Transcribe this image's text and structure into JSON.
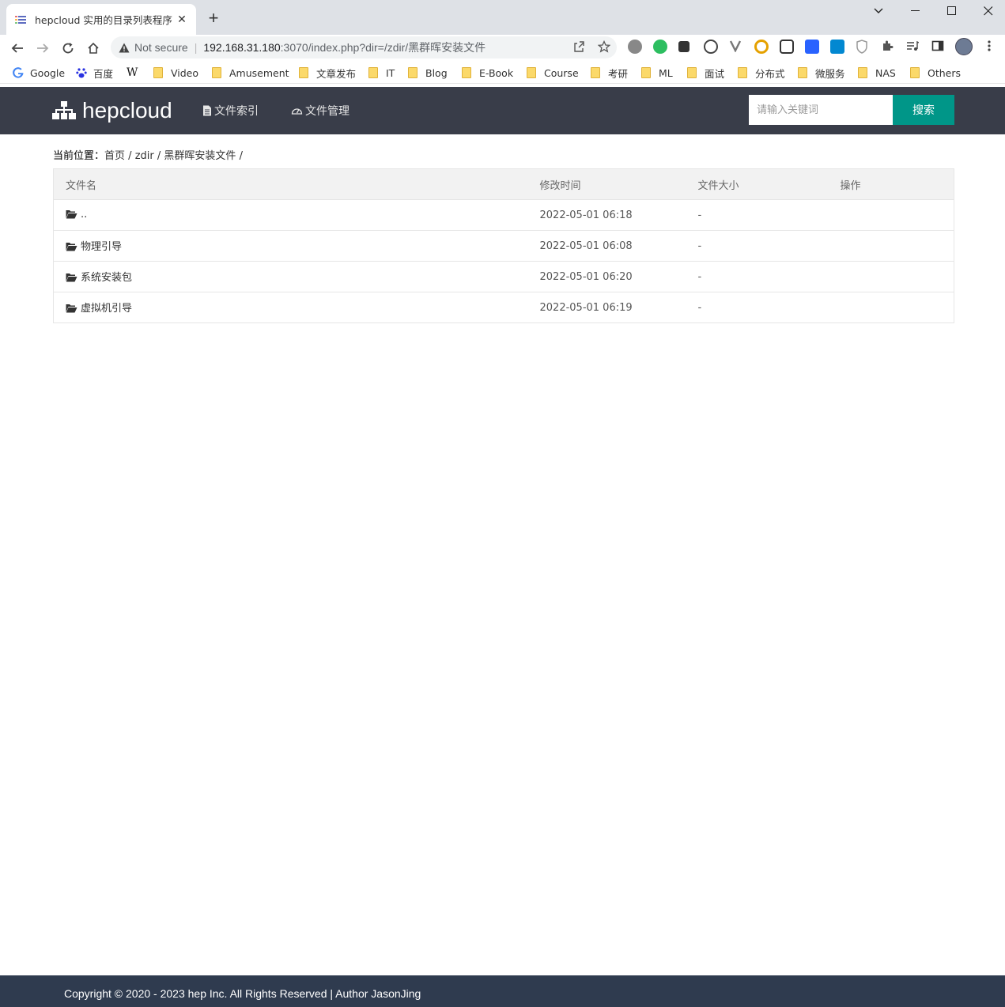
{
  "browser": {
    "tab_title": "hepcloud 实用的目录列表程序",
    "omnibox": {
      "security_label": "Not secure",
      "host": "192.168.31.180",
      "path": ":3070/index.php?dir=/zdir/黑群晖安装文件"
    },
    "bookmarks": [
      "Google",
      "百度",
      "Video",
      "Amusement",
      "文章发布",
      "IT",
      "Blog",
      "E-Book",
      "Course",
      "考研",
      "ML",
      "面试",
      "分布式",
      "微服务",
      "NAS",
      "Others"
    ]
  },
  "site": {
    "logo_text": "hepcloud",
    "nav": [
      {
        "label": "文件索引",
        "icon": "document-icon"
      },
      {
        "label": "文件管理",
        "icon": "dashboard-icon"
      }
    ],
    "search": {
      "placeholder": "请输入关键词",
      "button_label": "搜索"
    }
  },
  "breadcrumb": {
    "label": "当前位置：",
    "items": [
      "首页",
      "zdir",
      "黑群晖安装文件"
    ],
    "separator": "/"
  },
  "table": {
    "columns": [
      "文件名",
      "修改时间",
      "文件大小",
      "操作"
    ],
    "rows": [
      {
        "name": "..",
        "modified": "2022-05-01 06:18",
        "size": "-",
        "action": ""
      },
      {
        "name": "物理引导",
        "modified": "2022-05-01 06:08",
        "size": "-",
        "action": ""
      },
      {
        "name": "系统安装包",
        "modified": "2022-05-01 06:20",
        "size": "-",
        "action": ""
      },
      {
        "name": "虚拟机引导",
        "modified": "2022-05-01 06:19",
        "size": "-",
        "action": ""
      }
    ]
  },
  "footer": {
    "text": "Copyright © 2020 - 2023 hep Inc. All Rights Reserved | Author JasonJing"
  },
  "colors": {
    "header_bg": "#393d49",
    "accent": "#009688",
    "footer_bg": "#2f3b4f"
  }
}
